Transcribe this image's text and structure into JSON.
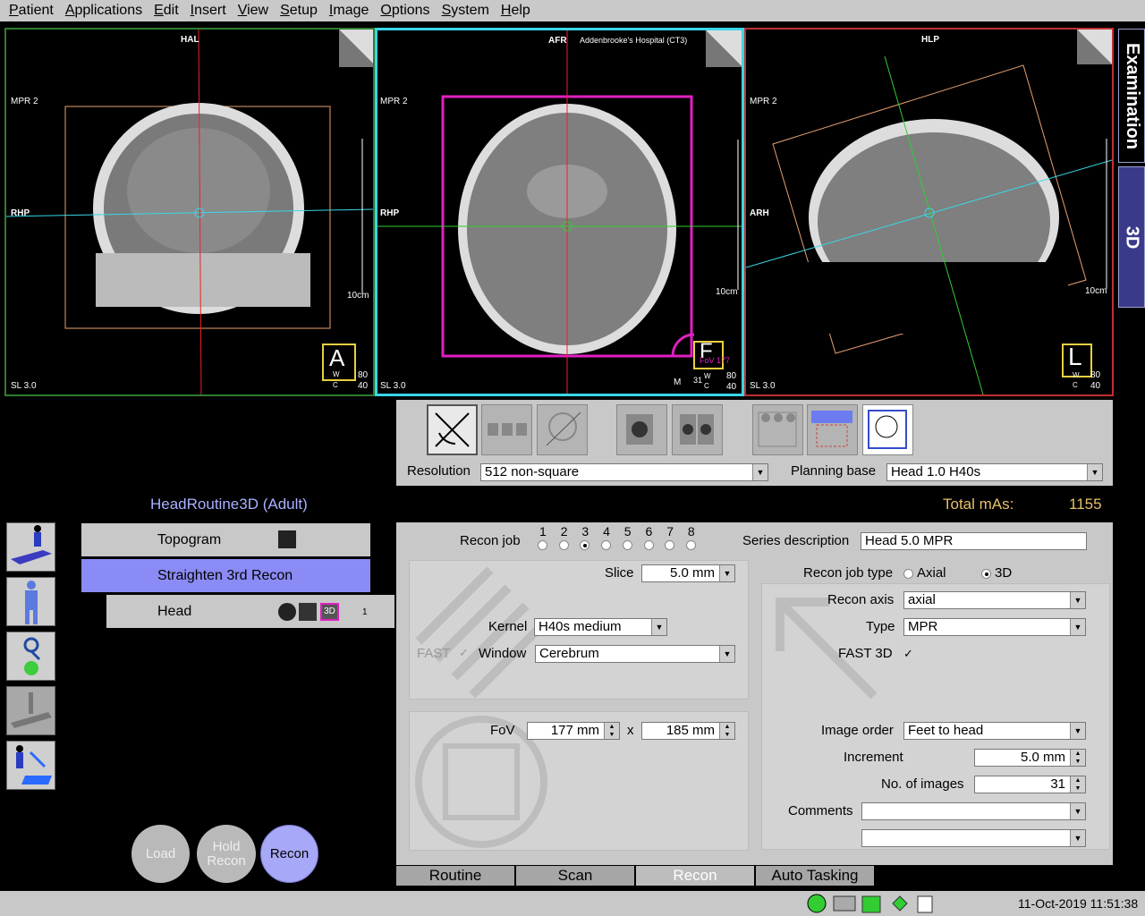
{
  "menu": [
    "Patient",
    "Applications",
    "Edit",
    "Insert",
    "View",
    "Setup",
    "Image",
    "Options",
    "System",
    "Help"
  ],
  "viewports": [
    {
      "orient_top": "HAL",
      "series": "MPR 2",
      "orient_left": "RHP",
      "slice": "SL 3.0",
      "scale": "10cm",
      "letter": "A",
      "w": "80",
      "c": "40",
      "w_lbl": "W",
      "c_lbl": "C"
    },
    {
      "orient_top": "AFR",
      "hospital": "Addenbrooke's Hospital (CT3)",
      "series": "MPR 2",
      "orient_left": "RHP",
      "slice": "SL 3.0",
      "scale": "10cm",
      "letter": "F",
      "w": "80",
      "c": "40",
      "w_lbl": "W",
      "c_lbl": "C",
      "m": "M",
      "n": "31",
      "fov": "FoV 177"
    },
    {
      "orient_top": "HLP",
      "series": "MPR 2",
      "orient_left": "ARH",
      "slice": "SL 3.0",
      "scale": "10cm",
      "letter": "L",
      "w": "80",
      "c": "40",
      "w_lbl": "W",
      "c_lbl": "C"
    }
  ],
  "right_tabs": {
    "examination": "Examination",
    "three_d": "3D"
  },
  "tools": {
    "resolution_label": "Resolution",
    "resolution_value": "512 non-square",
    "planning_label": "Planning base",
    "planning_value": "Head  1.0  H40s"
  },
  "protocol": "HeadRoutine3D (Adult)",
  "total_mas_label": "Total mAs:",
  "total_mas_value": "1155",
  "steps": {
    "topogram": "Topogram",
    "straighten": "Straighten 3rd Recon",
    "head": "Head",
    "head_num": "1",
    "three_d_badge": "3D"
  },
  "recon": {
    "job_label": "Recon job",
    "jobs": [
      "1",
      "2",
      "3",
      "4",
      "5",
      "6",
      "7",
      "8"
    ],
    "selected_job": 3,
    "series_desc_label": "Series description",
    "series_desc_value": "Head  5.0  MPR",
    "slice_label": "Slice",
    "slice_value": "5.0 mm",
    "job_type_label": "Recon job type",
    "axial_label": "Axial",
    "three_d_label": "3D",
    "kernel_label": "Kernel",
    "kernel_value": "H40s medium",
    "fast_label": "FAST",
    "window_label": "Window",
    "window_value": "Cerebrum",
    "axis_label": "Recon axis",
    "axis_value": "axial",
    "type_label": "Type",
    "type_value": "MPR",
    "fast3d_label": "FAST 3D",
    "fov_label": "FoV",
    "fov_x": "177 mm",
    "fov_x_sep": "x",
    "fov_y": "185 mm",
    "order_label": "Image order",
    "order_value": "Feet to head",
    "increment_label": "Increment",
    "increment_value": "5.0 mm",
    "noimg_label": "No. of images",
    "noimg_value": "31",
    "comments_label": "Comments"
  },
  "round_buttons": {
    "load": "Load",
    "hold": "Hold Recon",
    "recon": "Recon"
  },
  "bottom_tabs": [
    "Routine",
    "Scan",
    "Recon",
    "Auto Tasking"
  ],
  "status": {
    "datetime": "11-Oct-2019 11:51:38"
  }
}
